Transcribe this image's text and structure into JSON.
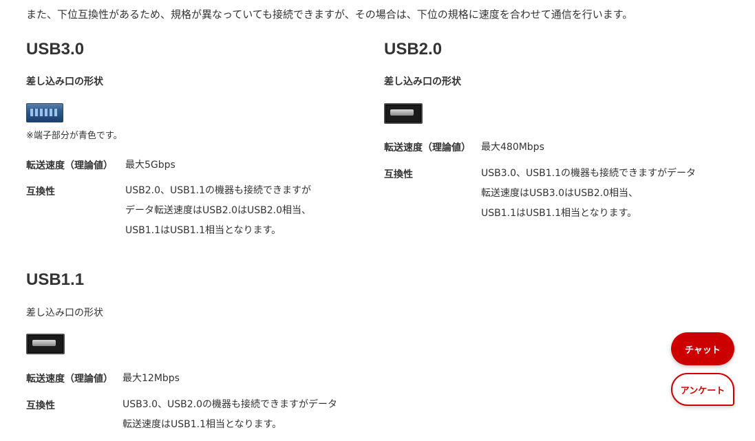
{
  "intro": "また、下位互換性があるため、規格が異なっていても接続できますが、その場合は、下位の規格に速度を合わせて通信を行います。",
  "sections": {
    "usb30": {
      "title": "USB3.0",
      "shape_label": "差し込み口の形状",
      "port_icon": "usb-3-port-blue-icon",
      "note": "※端子部分が青色です。",
      "speed_label": "転送速度（理論値）",
      "speed_value": "最大5Gbps",
      "compat_label": "互換性",
      "compat_lines": [
        "USB2.0、USB1.1の機器も接続できますが",
        "データ転送速度はUSB2.0はUSB2.0相当、",
        "USB1.1はUSB1.1相当となります。"
      ]
    },
    "usb20": {
      "title": "USB2.0",
      "shape_label": "差し込み口の形状",
      "port_icon": "usb-2-port-black-icon",
      "speed_label": "転送速度（理論値）",
      "speed_value": "最大480Mbps",
      "compat_label": "互換性",
      "compat_lines": [
        "USB3.0、USB1.1の機器も接続できますがデータ",
        "転送速度はUSB3.0はUSB2.0相当、",
        "USB1.1はUSB1.1相当となります。"
      ]
    },
    "usb11": {
      "title": "USB1.1",
      "shape_label": "差し込み口の形状",
      "port_icon": "usb-1-port-black-icon",
      "speed_label": "転送速度（理論値）",
      "speed_value": "最大12Mbps",
      "compat_label": "互換性",
      "compat_lines": [
        "USB3.0、USB2.0の機器も接続できますがデータ",
        "転送速度はUSB1.1相当となります。"
      ]
    }
  },
  "floating": {
    "chat_label": "チャット",
    "survey_label": "アンケート",
    "accent_color": "#cc0000"
  }
}
